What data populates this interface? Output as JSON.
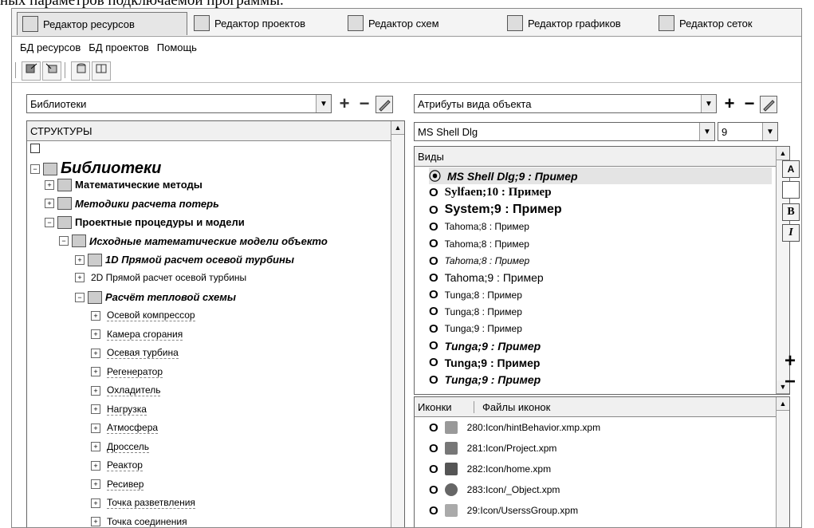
{
  "caption": "ных параметров подключаемой программы.",
  "tabs": [
    {
      "label": "Редактор ресурсов"
    },
    {
      "label": "Редактор проектов"
    },
    {
      "label": "Редактор схем"
    },
    {
      "label": "Редактор графиков"
    },
    {
      "label": "Редактор сеток"
    }
  ],
  "menu": [
    "БД ресурсов",
    "БД проектов",
    "Помощь"
  ],
  "left": {
    "library_combo": "Библиотеки",
    "panel_title": "СТРУКТУРЫ",
    "tree": [
      {
        "label": "Библиотеки",
        "level": 0,
        "style": "root"
      },
      {
        "label": "Математические методы",
        "level": 1,
        "style": "bold"
      },
      {
        "label": "Методики расчета потерь",
        "level": 1,
        "style": "bolditalic"
      },
      {
        "label": "Проектные процедуры и модели",
        "level": 1,
        "style": "bold"
      },
      {
        "label": "Исходные математические модели объекто",
        "level": 2,
        "style": "bolditalic"
      },
      {
        "label": "1D Прямой расчет осевой турбины",
        "level": 3,
        "style": "bolditalic"
      },
      {
        "label": "2D Прямой расчет осевой турбины",
        "level": 3,
        "style": "normal"
      },
      {
        "label": "Расчёт тепловой схемы",
        "level": 3,
        "style": "bolditalic"
      },
      {
        "label": "Осевой компрессор",
        "level": 4,
        "style": "normal"
      },
      {
        "label": "Камера сгорания",
        "level": 4,
        "style": "normal"
      },
      {
        "label": "Осевая турбина",
        "level": 4,
        "style": "normal"
      },
      {
        "label": "Регенератор",
        "level": 4,
        "style": "normal"
      },
      {
        "label": "Охладитель",
        "level": 4,
        "style": "normal"
      },
      {
        "label": "Нагрузка",
        "level": 4,
        "style": "normal"
      },
      {
        "label": "Атмосфера",
        "level": 4,
        "style": "normal"
      },
      {
        "label": "Дроссель",
        "level": 4,
        "style": "normal"
      },
      {
        "label": "Реактор",
        "level": 4,
        "style": "normal"
      },
      {
        "label": "Ресивер",
        "level": 4,
        "style": "normal"
      },
      {
        "label": "Точка разветвления",
        "level": 4,
        "style": "normal"
      },
      {
        "label": "Точка соединения",
        "level": 4,
        "style": "normal"
      }
    ]
  },
  "right": {
    "attr_combo": "Атрибуты вида объекта",
    "font_combo": "MS Shell Dlg",
    "size_combo": "9",
    "views_header": "Виды",
    "views": [
      {
        "label": "MS Shell Dlg;9 :  Пример",
        "style": "bolditalic",
        "selected": true
      },
      {
        "label": "Sylfaen;10 :  Пример",
        "style": "boldserif"
      },
      {
        "label": "System;9 :  Пример",
        "style": "boldbig"
      },
      {
        "label": "Tahoma;8 :  Пример",
        "style": "small"
      },
      {
        "label": "Tahoma;8 :  Пример",
        "style": "small"
      },
      {
        "label": "Tahoma;8 :  Пример",
        "style": "smallitalic"
      },
      {
        "label": "Tahoma;9 :  Пример",
        "style": "normal"
      },
      {
        "label": "Tunga;8 :  Пример",
        "style": "small"
      },
      {
        "label": "Tunga;8 :  Пример",
        "style": "small"
      },
      {
        "label": "Tunga;9 :  Пример",
        "style": "small"
      },
      {
        "label": "Tunga;9 :  Пример",
        "style": "bolditalic"
      },
      {
        "label": "Tunga;9 :  Пример",
        "style": "bold"
      },
      {
        "label": "Tunga;9 :  Пример",
        "style": "bolditalic"
      }
    ],
    "icons_col1": "Иконки",
    "icons_col2": "Файлы иконок",
    "icons": [
      {
        "label": "280:Icon/hintBehavior.xmp.xpm",
        "icon": "gear-icon"
      },
      {
        "label": "281:Icon/Project.xpm",
        "icon": "cube-icon"
      },
      {
        "label": "282:Icon/home.xpm",
        "icon": "home-icon"
      },
      {
        "label": "283:Icon/_Object.xpm",
        "icon": "globe-icon"
      },
      {
        "label": "29:Icon/UserssGroup.xpm",
        "icon": "group-icon"
      }
    ]
  },
  "side": {
    "bold_btn": "B",
    "italic_btn": "I",
    "plus": "+",
    "minus": "−",
    "font_btn": "A"
  },
  "glyphs": {
    "plus": "+",
    "minus": "−",
    "down": "▼",
    "up": "▲"
  }
}
